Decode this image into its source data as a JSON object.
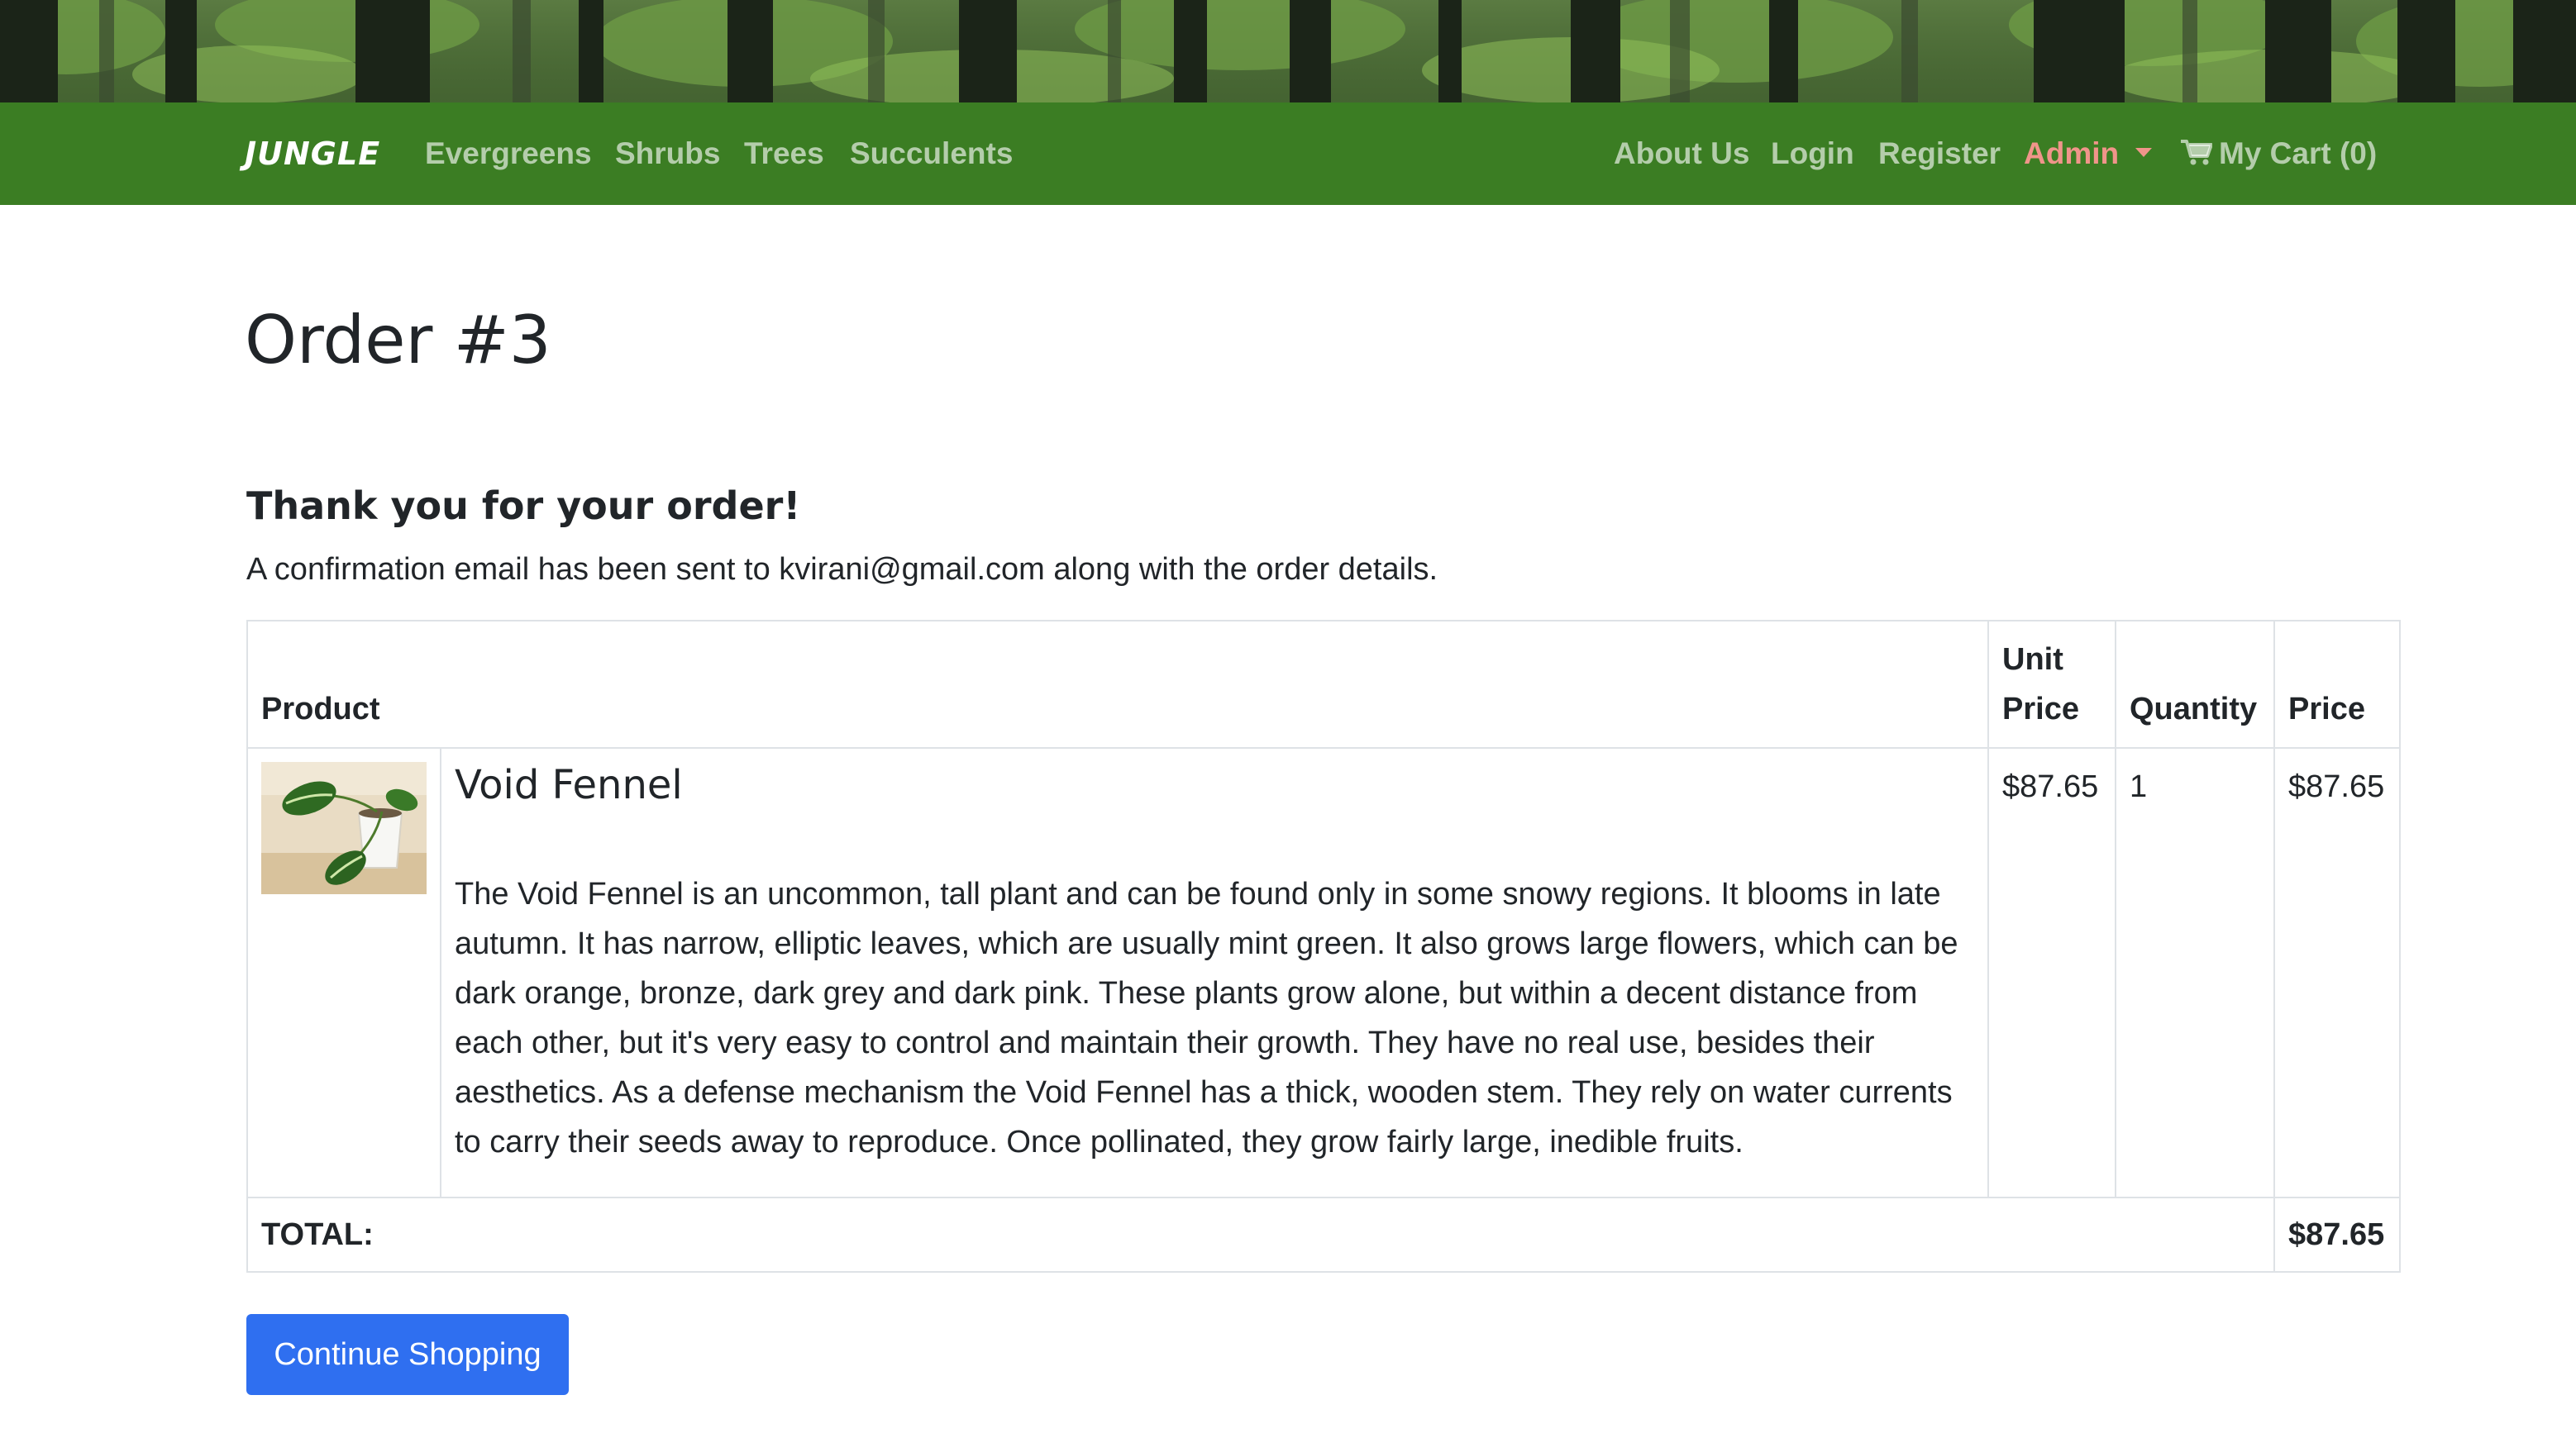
{
  "navbar": {
    "brand": "JUNGLE",
    "left_links": [
      "Evergreens",
      "Shrubs",
      "Trees",
      "Succulents"
    ],
    "about": "About Us",
    "login": "Login",
    "register": "Register",
    "admin": "Admin",
    "cart": "My Cart (0)"
  },
  "order": {
    "title": "Order #3",
    "thanks": "Thank you for your order!",
    "confirmation": "A confirmation email has been sent to kvirani@gmail.com along with the order details."
  },
  "table": {
    "headers": {
      "product": "Product",
      "unit_price_line1": "Unit",
      "unit_price_line2": "Price",
      "quantity": "Quantity",
      "price": "Price"
    },
    "items": [
      {
        "name": "Void Fennel",
        "description": "The Void Fennel is an uncommon, tall plant and can be found only in some snowy regions. It blooms in late autumn. It has narrow, elliptic leaves, which are usually mint green. It also grows large flowers, which can be dark orange, bronze, dark grey and dark pink. These plants grow alone, but within a decent distance from each other, but it's very easy to control and maintain their growth. They have no real use, besides their aesthetics. As a defense mechanism the Void Fennel has a thick, wooden stem. They rely on water currents to carry their seeds away to reproduce. Once pollinated, they grow fairly large, inedible fruits.",
        "unit_price": "$87.65",
        "quantity": "1",
        "price": "$87.65",
        "image_icon": "potted-plant-image"
      }
    ],
    "total_label": "TOTAL:",
    "total_value": "$87.65"
  },
  "buttons": {
    "continue": "Continue Shopping"
  },
  "colors": {
    "navbar_bg": "#3b7d23",
    "nav_link": "rgba(255,255,255,0.62)",
    "admin_link": "#f0958a",
    "button_bg": "#2f6ff0",
    "border": "#dee2e6"
  }
}
